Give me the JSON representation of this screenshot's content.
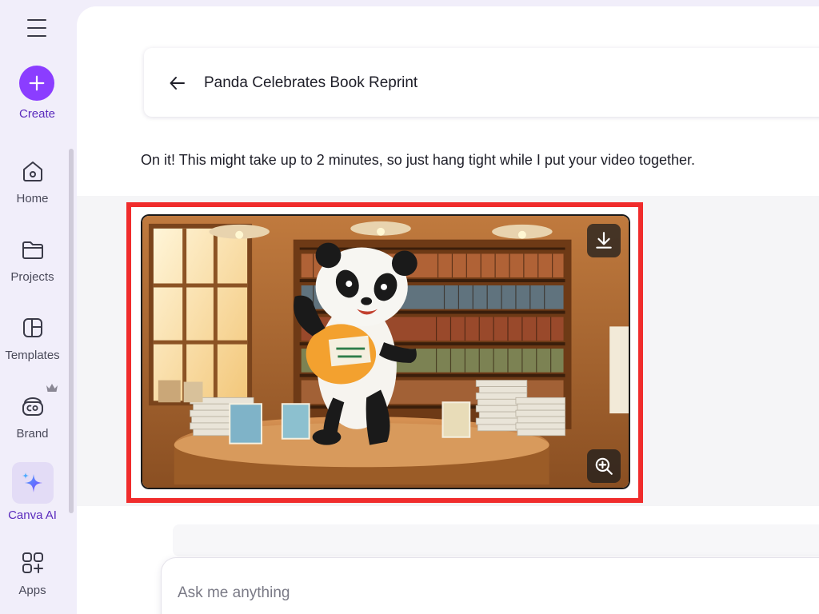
{
  "sidebar": {
    "create_label": "Create",
    "items": [
      {
        "label": "Home",
        "icon": "home-icon"
      },
      {
        "label": "Projects",
        "icon": "folder-icon"
      },
      {
        "label": "Templates",
        "icon": "templates-icon"
      },
      {
        "label": "Brand",
        "icon": "brand-icon"
      },
      {
        "label": "Canva AI",
        "icon": "sparkle-icon"
      },
      {
        "label": "Apps",
        "icon": "apps-icon"
      }
    ]
  },
  "chat": {
    "title": "Panda Celebrates Book Reprint",
    "message": "On it! This might take up to 2 minutes, so just hang tight while I put your video together.",
    "media_alt": "Cartoon panda dancing in a bookstore"
  },
  "composer": {
    "placeholder": "Ask me anything"
  },
  "colors": {
    "accent": "#8b3dff",
    "highlight_border": "#f02c2c"
  }
}
